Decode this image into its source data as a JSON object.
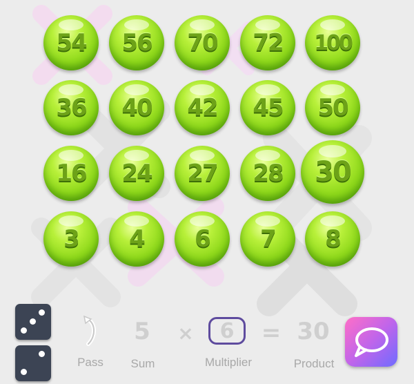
{
  "balls": [
    {
      "value": "54"
    },
    {
      "value": "56"
    },
    {
      "value": "70"
    },
    {
      "value": "72"
    },
    {
      "value": "100"
    },
    {
      "value": "36"
    },
    {
      "value": "40"
    },
    {
      "value": "42"
    },
    {
      "value": "45"
    },
    {
      "value": "50"
    },
    {
      "value": "16"
    },
    {
      "value": "24"
    },
    {
      "value": "27"
    },
    {
      "value": "28"
    },
    {
      "value": "30"
    },
    {
      "value": "3"
    },
    {
      "value": "4"
    },
    {
      "value": "6"
    },
    {
      "value": "7"
    },
    {
      "value": "8"
    }
  ],
  "highlighted_value": "30",
  "dice": {
    "top_face": 3,
    "bottom_face": 2
  },
  "equation": {
    "sum": "5",
    "operator": "×",
    "multiplier": "6",
    "equals": "=",
    "product": "30"
  },
  "labels": {
    "pass": "Pass",
    "sum": "Sum",
    "multiplier": "Multiplier",
    "product": "Product"
  },
  "icons": {
    "pass": "pass-arrow-icon",
    "chat": "chat-bubble-icon"
  },
  "colors": {
    "ball_green": "#8ed81a",
    "die": "#3c4454",
    "multiplier_border": "#5e4b9e",
    "chat_gradient_start": "#ff6fc7",
    "chat_gradient_end": "#6f6bff"
  }
}
